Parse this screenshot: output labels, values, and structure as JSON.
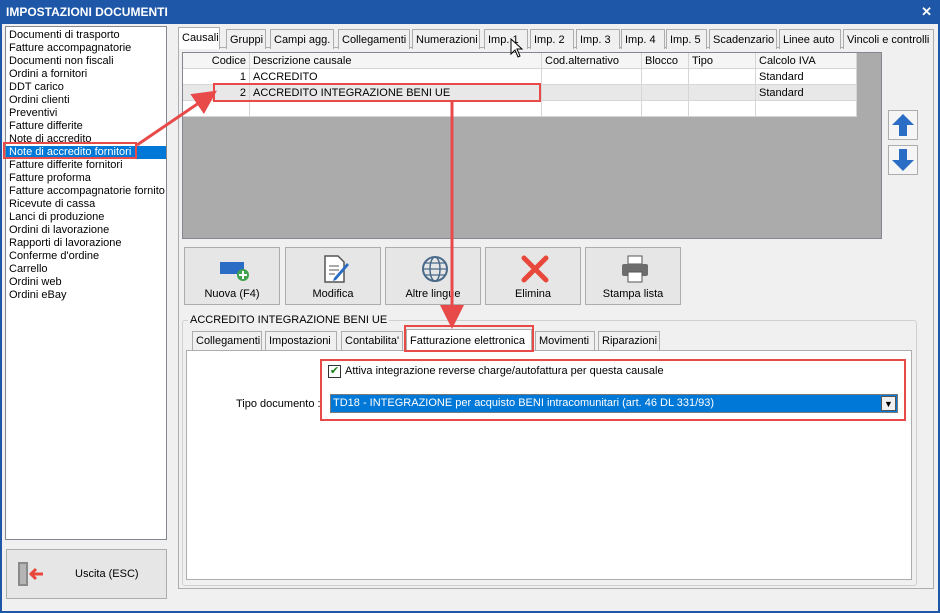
{
  "window": {
    "title": "IMPOSTAZIONI DOCUMENTI",
    "close": "✕"
  },
  "doc_list": [
    "Documenti di trasporto",
    "Fatture accompagnatorie",
    "Documenti non fiscali",
    "Ordini a fornitori",
    "DDT carico",
    "Ordini clienti",
    "Preventivi",
    "Fatture differite",
    "Note di accredito",
    "Note di accredito fornitori",
    "Fatture differite fornitori",
    "Fatture proforma",
    "Fatture accompagnatorie fornito",
    "Ricevute di cassa",
    "Lanci di produzione",
    "Ordini di lavorazione",
    "Rapporti di lavorazione",
    "Conferme d'ordine",
    "Carrello",
    "Ordini web",
    "Ordini eBay"
  ],
  "exit": {
    "label": "Uscita (ESC)"
  },
  "tabs": [
    "Causali",
    "Gruppi",
    "Campi agg.",
    "Collegamenti",
    "Numerazioni",
    "Imp. 1",
    "Imp. 2",
    "Imp. 3",
    "Imp. 4",
    "Imp. 5",
    "Scadenzario",
    "Linee auto",
    "Vincoli e controlli"
  ],
  "grid": {
    "columns": [
      "Codice",
      "Descrizione causale",
      "Cod.alternativo",
      "Blocco",
      "Tipo",
      "Calcolo IVA"
    ],
    "rows": [
      [
        "1",
        "ACCREDITO",
        "",
        "",
        "",
        "Standard"
      ],
      [
        "2",
        "ACCREDITO INTEGRAZIONE BENI UE",
        "",
        "",
        "",
        "Standard"
      ]
    ]
  },
  "actions": {
    "new": "Nuova (F4)",
    "edit": "Modifica",
    "languages": "Altre lingue",
    "delete": "Elimina",
    "print": "Stampa lista"
  },
  "detail": {
    "group_title": "ACCREDITO INTEGRAZIONE BENI UE",
    "tabs": [
      "Collegamenti",
      "Impostazioni",
      "Contabilita'",
      "Fatturazione elettronica",
      "Movimenti",
      "Riparazioni"
    ],
    "checkbox_label": "Attiva integrazione reverse charge/autofattura per questa causale",
    "checkbox_mark": "✔",
    "tipo_label": "Tipo documento :",
    "tipo_value": "TD18 - INTEGRAZIONE per acquisto BENI intracomunitari (art. 46 DL 331/93)"
  },
  "colors": {
    "title_bar": "#1e57a8",
    "selection": "#0078d7",
    "highlight": "#e84a4a"
  }
}
